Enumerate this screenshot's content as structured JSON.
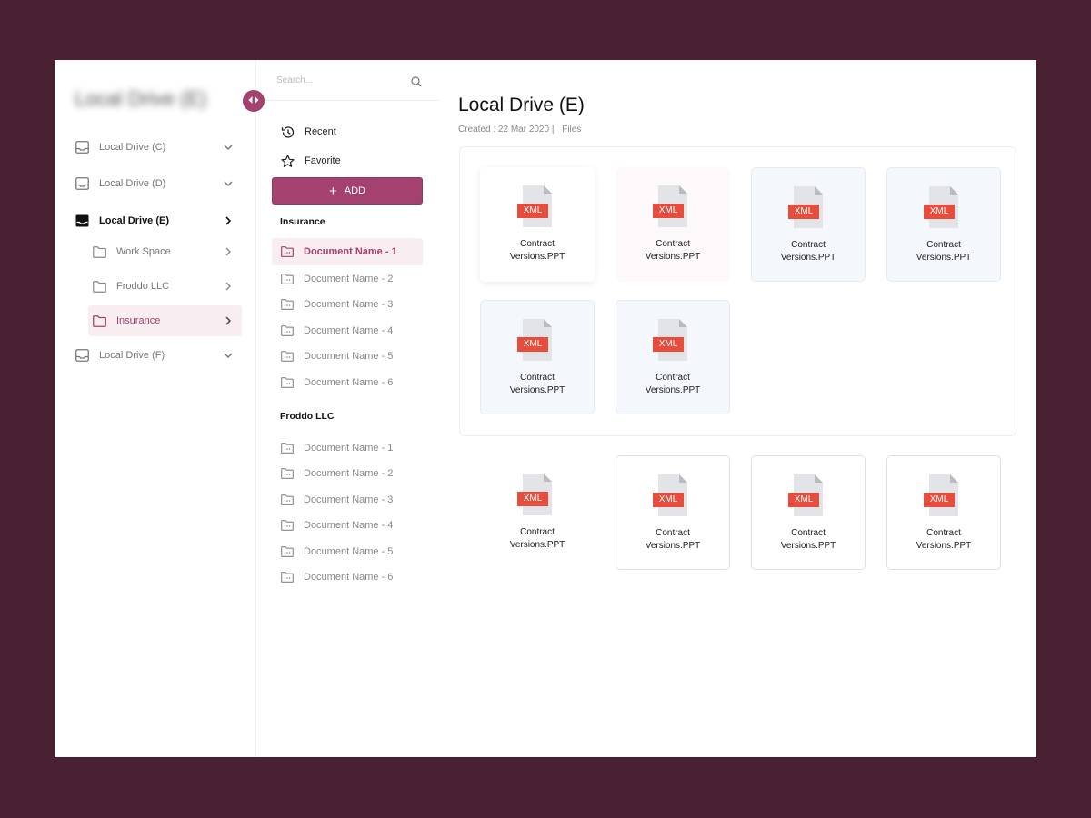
{
  "sidebar": {
    "title": "Local Drive (E)",
    "items": [
      {
        "label": "Local Drive (C)",
        "icon": "drive-icon"
      },
      {
        "label": "Local Drive (D)",
        "icon": "drive-icon"
      },
      {
        "label": "Local Drive (E)",
        "icon": "drive-icon",
        "active": true
      },
      {
        "label": "Work Space",
        "icon": "folder-icon"
      },
      {
        "label": "Froddo LLC",
        "icon": "folder-icon"
      },
      {
        "label": "Insurance",
        "icon": "folder-icon",
        "selected": true
      },
      {
        "label": "Local Drive (F)",
        "icon": "drive-icon"
      }
    ]
  },
  "search": {
    "placeholder": "Search..."
  },
  "nav": {
    "recent": "Recent",
    "favorite": "Favorite"
  },
  "add_label": "ADD",
  "sections": [
    {
      "title": "Insurance",
      "items": [
        "Document Name - 1",
        "Document Name - 2",
        "Document Name - 3",
        "Document Name - 4",
        "Document Name - 5",
        "Document Name - 6"
      ]
    },
    {
      "title": "Froddo LLC",
      "items": [
        "Document Name - 1",
        "Document Name - 2",
        "Document Name - 3",
        "Document Name - 4",
        "Document Name - 5",
        "Document Name - 6"
      ]
    }
  ],
  "main": {
    "title": "Local Drive (E)",
    "created": "Created : 22 Mar 2020 |",
    "files_label": "Files",
    "files": [
      {
        "badge": "XML",
        "name": "Contract Versions.PPT"
      },
      {
        "badge": "XML",
        "name": "Contract Versions.PPT"
      },
      {
        "badge": "XML",
        "name": "Contract Versions.PPT"
      },
      {
        "badge": "XML",
        "name": "Contract Versions.PPT"
      },
      {
        "badge": "XML",
        "name": "Contract Versions.PPT"
      },
      {
        "badge": "XML",
        "name": "Contract Versions.PPT"
      },
      {
        "badge": "XML",
        "name": "Contract Versions.PPT"
      },
      {
        "badge": "XML",
        "name": "Contract Versions.PPT"
      },
      {
        "badge": "XML",
        "name": "Contract Versions.PPT"
      },
      {
        "badge": "XML",
        "name": "Contract Versions.PPT"
      }
    ]
  },
  "colors": {
    "accent": "#a4416e",
    "badge": "#e84c3d",
    "background": "#4a2132"
  }
}
